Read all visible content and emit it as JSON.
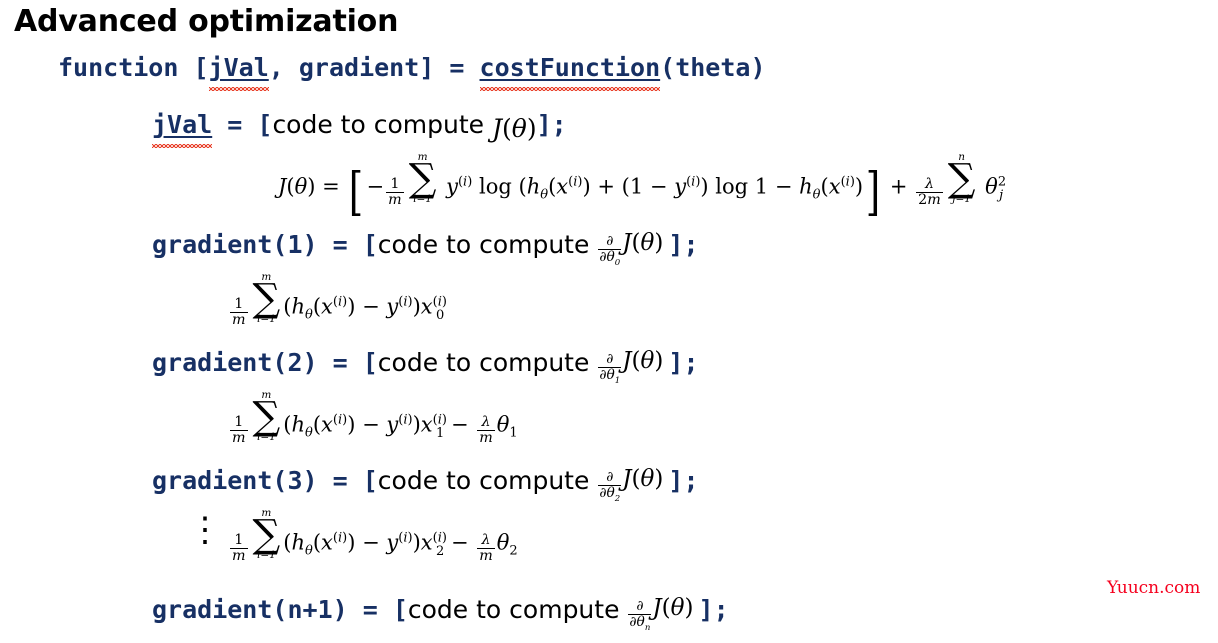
{
  "slide": {
    "title": "Advanced optimization",
    "background_color": "#ffffff",
    "code_color": "#173064",
    "prose_color": "#000000",
    "spellcheck_underline_color": "#e8402a"
  },
  "signature_line": {
    "keyword": "function",
    "space1": " ",
    "open_bracket": "[",
    "out1": "jVal",
    "comma": ", ",
    "out2": "gradient",
    "close_bracket": "]",
    "equals": " = ",
    "fn_name": "costFunction",
    "args": "(theta)"
  },
  "jval_line": {
    "var": "jVal",
    "equals": " = ",
    "open": "[",
    "prose": "code to compute ",
    "math_J": "J(θ)",
    "close": "]",
    "semicolon": ";"
  },
  "cost_formula": {
    "lhs": "J(θ) =",
    "expr": "[ -1/m Σ i=1..m y^(i) log ( hθ(x^(i)) + (1 - y^(i)) log 1 - hθ(x^(i)) ] + λ/2m Σ j=1..n θ²_j",
    "sum_upper_1": "m",
    "sum_lower_1": "i=1",
    "sum_upper_2": "n",
    "sum_lower_2": "j=1",
    "frac_num_1": "1",
    "frac_den_1": "m",
    "frac_num_2": "λ",
    "frac_den_2": "2m"
  },
  "gradients": [
    {
      "name": "gradient(1)",
      "equals": " = ",
      "open": "[",
      "prose": "code to compute ",
      "pd_num": "∂",
      "pd_den": "∂θ",
      "pd_index": "0",
      "J": "J(θ)",
      "close": "]",
      "semicolon": ";",
      "formula": {
        "frac_num": "1",
        "frac_den": "m",
        "sum_upper": "m",
        "sum_lower": "i=1",
        "body": "(hθ(x^(i)) - y^(i))x^(i)_0",
        "x_sub": "0",
        "reg_term": ""
      }
    },
    {
      "name": "gradient(2)",
      "equals": " = ",
      "open": "[",
      "prose": "code to compute ",
      "pd_num": "∂",
      "pd_den": "∂θ",
      "pd_index": "1",
      "J": "J(θ)",
      "close": "]",
      "semicolon": ";",
      "formula": {
        "frac_num": "1",
        "frac_den": "m",
        "sum_upper": "m",
        "sum_lower": "i=1",
        "body": "(hθ(x^(i)) - y^(i))x^(i)_1",
        "x_sub": "1",
        "reg_term": "- λ/m θ_1",
        "reg_num": "λ",
        "reg_den": "m",
        "reg_theta_sub": "1"
      }
    },
    {
      "name": "gradient(3)",
      "equals": " = ",
      "open": "[",
      "prose": "code to compute ",
      "pd_num": "∂",
      "pd_den": "∂θ",
      "pd_index": "2",
      "J": "J(θ)",
      "close": "]",
      "semicolon": ";",
      "formula": {
        "frac_num": "1",
        "frac_den": "m",
        "sum_upper": "m",
        "sum_lower": "i=1",
        "body": "(hθ(x^(i)) - y^(i))x^(i)_2",
        "x_sub": "2",
        "reg_term": "- λ/m θ_2",
        "reg_num": "λ",
        "reg_den": "m",
        "reg_theta_sub": "2"
      }
    },
    {
      "name": "gradient(n+1)",
      "equals": " = ",
      "open": "[",
      "prose": "code to compute ",
      "pd_num": "∂",
      "pd_den": "∂θ",
      "pd_index": "n",
      "J": "J(θ)",
      "close": "]",
      "semicolon": ";",
      "formula": null
    }
  ],
  "ellipsis": "⋮",
  "watermark": {
    "text": "Yuucn.com",
    "color": "#f5001e"
  }
}
